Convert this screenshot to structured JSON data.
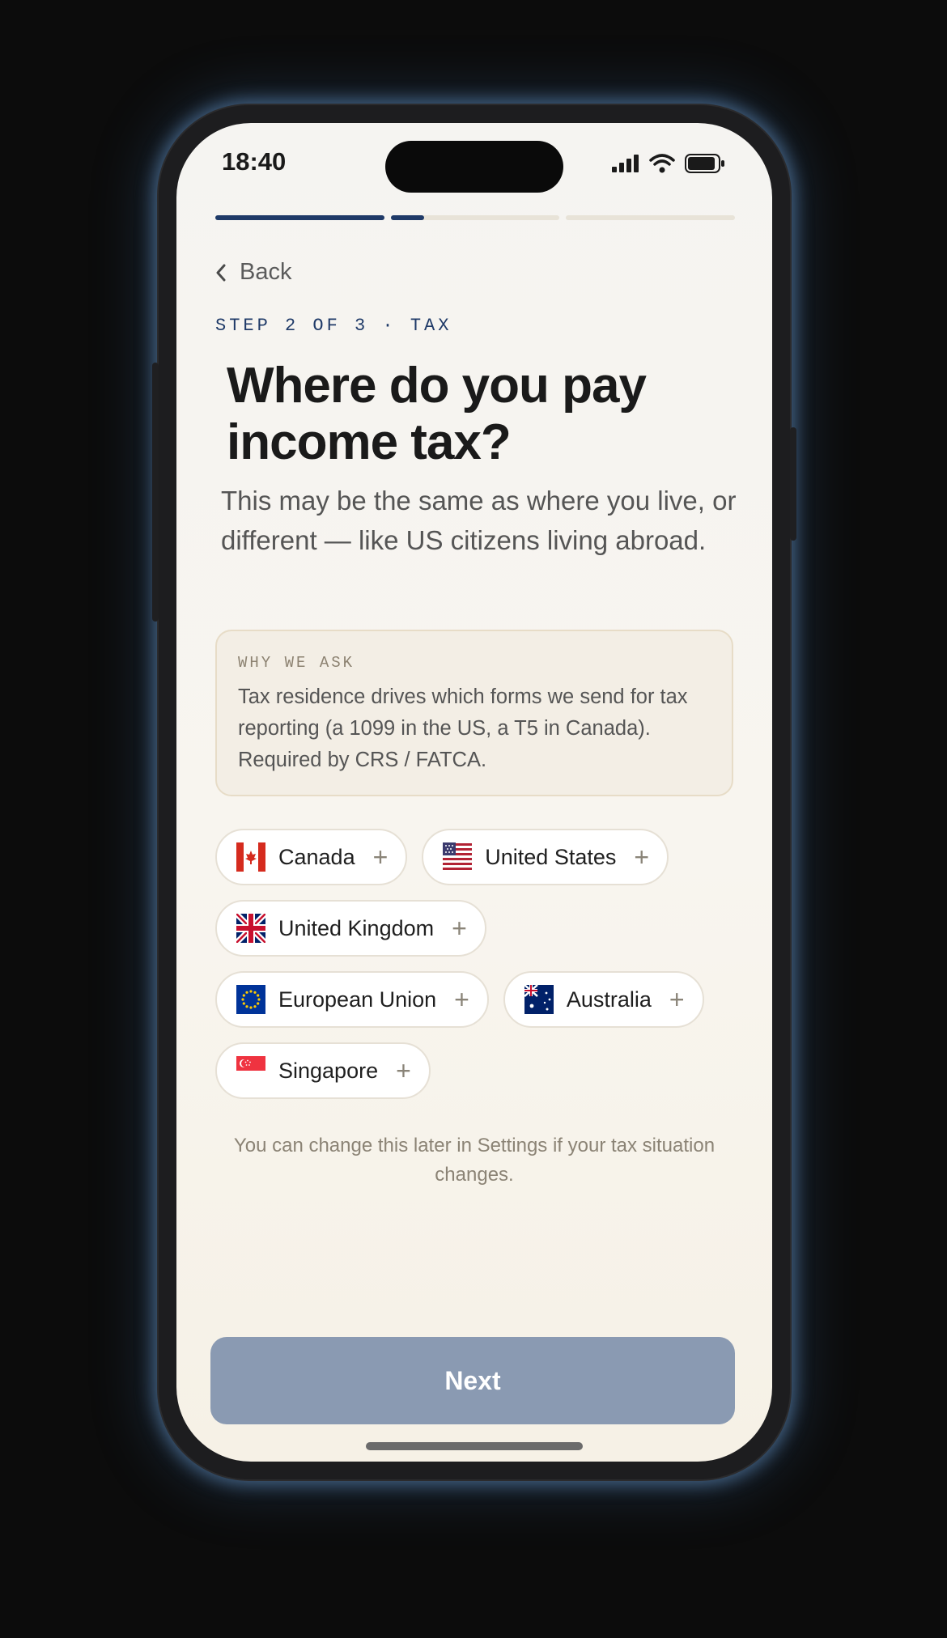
{
  "status_bar": {
    "time": "18:40",
    "icons": [
      "signal-icon",
      "wifi-icon",
      "battery-icon"
    ]
  },
  "progress": {
    "segments": [
      1.0,
      0.2,
      0.0
    ],
    "color_active": "#1f3a68",
    "color_track": "#e8e3d8"
  },
  "nav": {
    "back_label": "Back",
    "back_icon": "chevron-left-icon"
  },
  "header": {
    "eyebrow": "STEP 2 OF 3 · TAX",
    "title": "Where do you pay income tax?",
    "subtitle": "This may be the same as where you live, or different — like US citizens living abroad."
  },
  "info": {
    "heading": "WHY WE ASK",
    "text": "Tax residence drives which forms we send for tax reporting (a 1099 in the US, a T5 in Canada). Required by CRS / FATCA."
  },
  "countries": [
    {
      "label": "Canada",
      "icon": "canada-flag-icon",
      "selected": false
    },
    {
      "label": "United States",
      "icon": "us-flag-icon",
      "selected": false
    },
    {
      "label": "United Kingdom",
      "icon": "uk-flag-icon",
      "selected": false
    },
    {
      "label": "European Union",
      "icon": "eu-flag-icon",
      "selected": false
    },
    {
      "label": "Australia",
      "icon": "australia-flag-icon",
      "selected": false
    },
    {
      "label": "Singapore",
      "icon": "singapore-flag-icon",
      "selected": false
    }
  ],
  "chip_add_symbol": "+",
  "footnote": "You can change this later in Settings if your tax situation changes.",
  "next_button": {
    "label": "Next",
    "disabled": true,
    "color": "#8a9ab2"
  },
  "colors": {
    "accent": "#1f3a68",
    "background": "#f5f4f1"
  }
}
